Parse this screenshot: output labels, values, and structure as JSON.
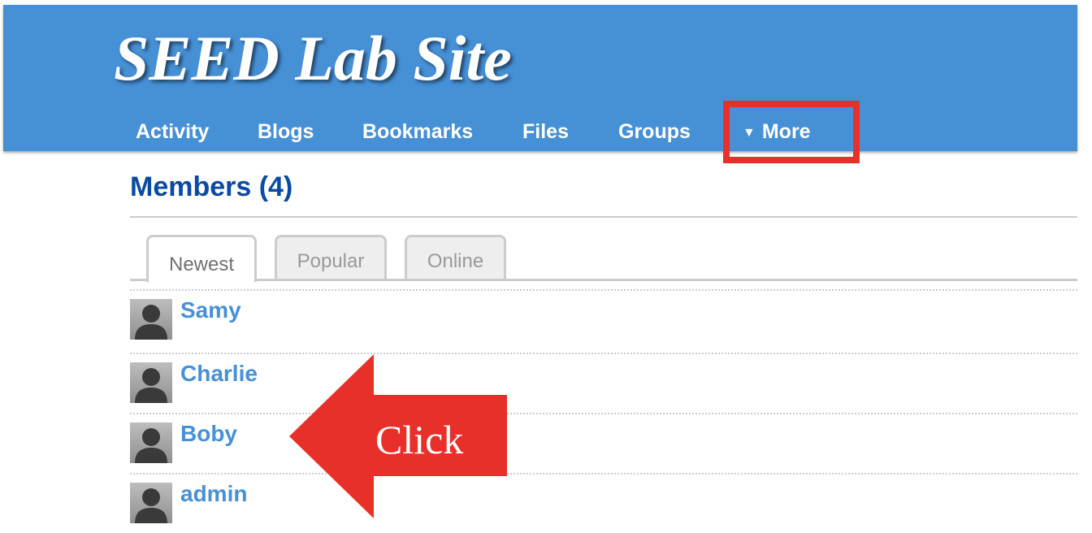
{
  "site": {
    "title": "SEED Lab Site",
    "nav": [
      {
        "label": "Activity"
      },
      {
        "label": "Blogs"
      },
      {
        "label": "Bookmarks"
      },
      {
        "label": "Files"
      },
      {
        "label": "Groups"
      },
      {
        "label": "More",
        "icon": "caret-down-icon",
        "caret": "▼"
      }
    ]
  },
  "members": {
    "heading": "Members (4)",
    "tabs": [
      {
        "label": "Newest",
        "selected": true
      },
      {
        "label": "Popular",
        "selected": false
      },
      {
        "label": "Online",
        "selected": false
      }
    ],
    "list": [
      {
        "name": "Samy"
      },
      {
        "name": "Charlie"
      },
      {
        "name": "Boby"
      },
      {
        "name": "admin"
      }
    ]
  },
  "annotation": {
    "arrow_text": "Click",
    "color": "#e8302a"
  },
  "colors": {
    "header_bg": "#4690d6",
    "link": "#4690d6",
    "heading": "#0b4aa3"
  }
}
